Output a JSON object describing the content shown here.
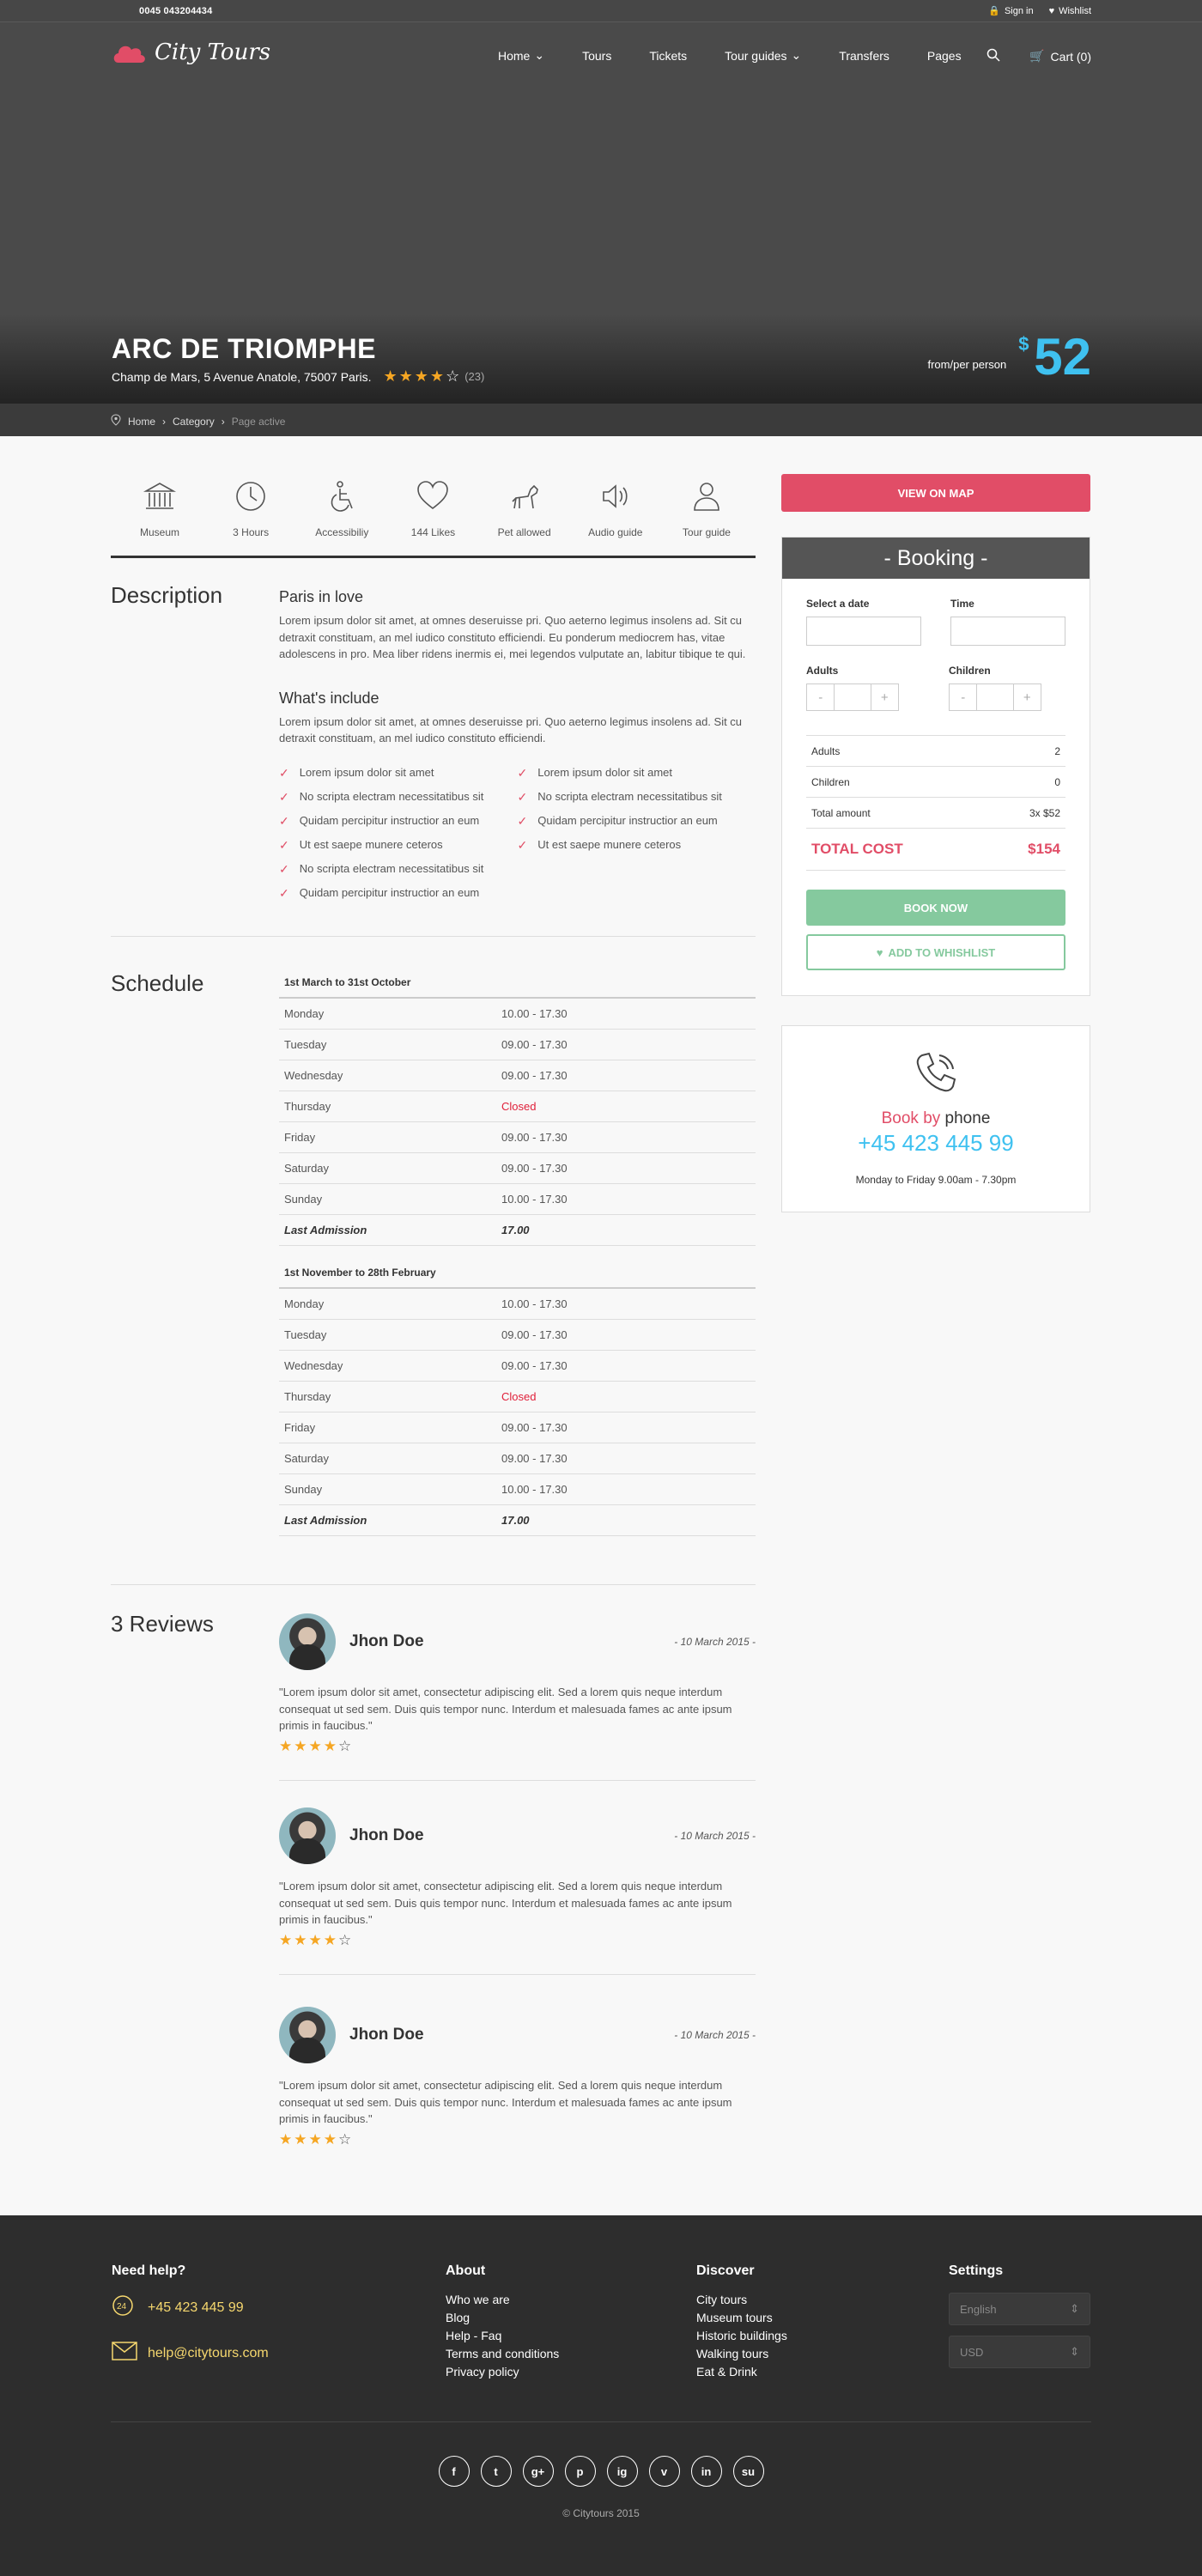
{
  "topbar": {
    "phone": "0045 043204434",
    "signin": "Sign in",
    "wishlist": "Wishlist"
  },
  "header": {
    "logo": "City Tours",
    "nav": [
      {
        "label": "Home",
        "dropdown": true
      },
      {
        "label": "Tours",
        "dropdown": false
      },
      {
        "label": "Tickets",
        "dropdown": false
      },
      {
        "label": "Tour guides",
        "dropdown": true
      },
      {
        "label": "Transfers",
        "dropdown": false
      },
      {
        "label": "Pages",
        "dropdown": false
      }
    ],
    "cart": "Cart (0)"
  },
  "hero": {
    "title": "ARC DE TRIOMPHE",
    "address": "Champ de Mars, 5 Avenue Anatole, 75007 Paris.",
    "rating": 4,
    "rating_count": "(23)",
    "price_prefix": "from/per person",
    "currency": "$",
    "price": "52"
  },
  "breadcrumb": {
    "home": "Home",
    "category": "Category",
    "active": "Page active"
  },
  "features": [
    {
      "label": "Museum",
      "icon": "museum-icon"
    },
    {
      "label": "3 Hours",
      "icon": "clock-icon"
    },
    {
      "label": "Accessibiliy",
      "icon": "wheelchair-icon"
    },
    {
      "label": "144 Likes",
      "icon": "heart-icon"
    },
    {
      "label": "Pet allowed",
      "icon": "dog-icon"
    },
    {
      "label": "Audio guide",
      "icon": "audio-icon"
    },
    {
      "label": "Tour guide",
      "icon": "guide-icon"
    }
  ],
  "description": {
    "heading": "Description",
    "sub1": "Paris in love",
    "text1": "Lorem ipsum dolor sit amet, at omnes deseruisse pri. Quo aeterno legimus insolens ad. Sit cu detraxit constituam, an mel iudico constituto efficiendi. Eu ponderum mediocrem has, vitae adolescens in pro. Mea liber ridens inermis ei, mei legendos vulputate an, labitur tibique te qui.",
    "sub2": "What's include",
    "text2": "Lorem ipsum dolor sit amet, at omnes deseruisse pri. Quo aeterno legimus insolens ad. Sit cu detraxit constituam, an mel iudico constituto efficiendi.",
    "includes_left": [
      "Lorem ipsum dolor sit amet",
      "No scripta electram necessitatibus sit",
      "Quidam percipitur instructior an eum",
      "Ut est saepe munere ceteros",
      "No scripta electram necessitatibus sit",
      "Quidam percipitur instructior an eum"
    ],
    "includes_right": [
      "Lorem ipsum dolor sit amet",
      "No scripta electram necessitatibus sit",
      "Quidam percipitur instructior an eum",
      "Ut est saepe munere ceteros"
    ]
  },
  "schedule": {
    "heading": "Schedule",
    "tables": [
      {
        "title": "1st March to 31st October",
        "rows": [
          {
            "day": "Monday",
            "hours": "10.00 - 17.30"
          },
          {
            "day": "Tuesday",
            "hours": "09.00 - 17.30"
          },
          {
            "day": "Wednesday",
            "hours": "09.00 - 17.30"
          },
          {
            "day": "Thursday",
            "hours": "Closed"
          },
          {
            "day": "Friday",
            "hours": "09.00 - 17.30"
          },
          {
            "day": "Saturday",
            "hours": "09.00 - 17.30"
          },
          {
            "day": "Sunday",
            "hours": "10.00 - 17.30"
          },
          {
            "day": "Last Admission",
            "hours": "17.00"
          }
        ]
      },
      {
        "title": "1st November to 28th February",
        "rows": [
          {
            "day": "Monday",
            "hours": "10.00 - 17.30"
          },
          {
            "day": "Tuesday",
            "hours": "09.00 - 17.30"
          },
          {
            "day": "Wednesday",
            "hours": "09.00 - 17.30"
          },
          {
            "day": "Thursday",
            "hours": "Closed"
          },
          {
            "day": "Friday",
            "hours": "09.00 - 17.30"
          },
          {
            "day": "Saturday",
            "hours": "09.00 - 17.30"
          },
          {
            "day": "Sunday",
            "hours": "10.00 - 17.30"
          },
          {
            "day": "Last Admission",
            "hours": "17.00"
          }
        ]
      }
    ]
  },
  "reviews": {
    "heading": "3 Reviews",
    "items": [
      {
        "name": "Jhon Doe",
        "date": "- 10 March 2015 -",
        "text": "\"Lorem ipsum dolor sit amet, consectetur adipiscing elit. Sed a lorem quis neque interdum consequat ut sed sem. Duis quis tempor nunc. Interdum et malesuada fames ac ante ipsum primis in faucibus.\"",
        "rating": 4
      },
      {
        "name": "Jhon Doe",
        "date": "- 10 March 2015 -",
        "text": "\"Lorem ipsum dolor sit amet, consectetur adipiscing elit. Sed a lorem quis neque interdum consequat ut sed sem. Duis quis tempor nunc. Interdum et malesuada fames ac ante ipsum primis in faucibus.\"",
        "rating": 4
      },
      {
        "name": "Jhon Doe",
        "date": "- 10 March 2015 -",
        "text": "\"Lorem ipsum dolor sit amet, consectetur adipiscing elit. Sed a lorem quis neque interdum consequat ut sed sem. Duis quis tempor nunc. Interdum et malesuada fames ac ante ipsum primis in faucibus.\"",
        "rating": 4
      }
    ]
  },
  "sidebar": {
    "map_button": "VIEW ON MAP",
    "booking": {
      "title": "- Booking -",
      "date_label": "Select a date",
      "time_label": "Time",
      "adults_label": "Adults",
      "children_label": "Children",
      "minus": "-",
      "plus": "+",
      "summary": [
        {
          "label": "Adults",
          "value": "2"
        },
        {
          "label": "Children",
          "value": "0"
        },
        {
          "label": "Total amount",
          "value": "3x $52"
        }
      ],
      "total_label": "TOTAL COST",
      "total_value": "$154",
      "book_button": "BOOK NOW",
      "wishlist_button": "ADD TO WHISHLIST"
    },
    "phone": {
      "book_by": "Book by",
      "phone_word": "phone",
      "number": "+45 423 445 99",
      "hours": "Monday to Friday 9.00am - 7.30pm"
    }
  },
  "footer": {
    "help": {
      "title": "Need help?",
      "phone": "+45 423 445 99",
      "email": "help@citytours.com"
    },
    "about": {
      "title": "About",
      "links": [
        "Who we are",
        "Blog",
        "Help - Faq",
        "Terms and conditions",
        "Privacy policy"
      ]
    },
    "discover": {
      "title": "Discover",
      "links": [
        "City tours",
        "Museum tours",
        "Historic buildings",
        "Walking tours",
        "Eat & Drink"
      ]
    },
    "settings": {
      "title": "Settings",
      "language": "English",
      "currency": "USD"
    },
    "social": [
      "f",
      "t",
      "g+",
      "p",
      "ig",
      "v",
      "in",
      "su"
    ],
    "copyright": "© Citytours 2015"
  },
  "colors": {
    "accent": "#e14d67",
    "price": "#3fc1f0",
    "book": "#85c99e",
    "star": "#f5a623"
  }
}
